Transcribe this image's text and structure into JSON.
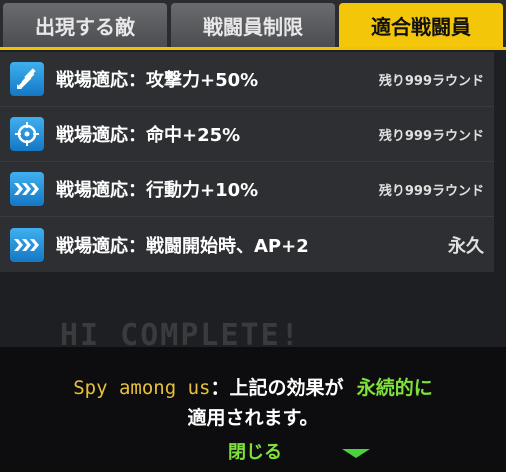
{
  "tabs": [
    {
      "label": "出現する敵",
      "active": false
    },
    {
      "label": "戦闘員制限",
      "active": false
    },
    {
      "label": "適合戦闘員",
      "active": true
    }
  ],
  "effects": [
    {
      "icon": "attack-up-icon",
      "label": "戦場適応：攻撃力+50%",
      "remaining": "残り999ラウンド"
    },
    {
      "icon": "crosshair-icon",
      "label": "戦場適応：命中+25%",
      "remaining": "残り999ラウンド"
    },
    {
      "icon": "speed-arrows-icon",
      "label": "戦場適応：行動力+10%",
      "remaining": "残り999ラウンド"
    },
    {
      "icon": "speed-arrows-icon",
      "label": "戦場適応：戦闘開始時、AP+2",
      "remaining": "永久"
    }
  ],
  "message": {
    "name": "Spy among us",
    "text_part1": "：上記の効果が",
    "highlight": "永続的に",
    "text_part2": "適用されます。"
  },
  "close_label": "閉じる",
  "background": {
    "ghost_text": "HI COMPLETE!"
  },
  "colors": {
    "accent": "#f4c60a",
    "icon_blue": "#2a93dc",
    "highlight_green": "#7ee23a",
    "name_gold": "#e8c13a"
  }
}
